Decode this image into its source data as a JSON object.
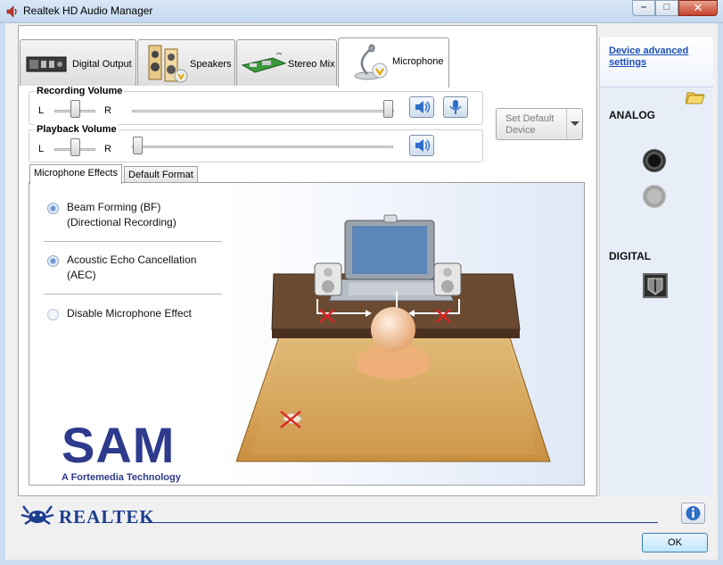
{
  "window": {
    "title": "Realtek HD Audio Manager"
  },
  "device_tabs": [
    {
      "label": "Digital Output",
      "icon": "digital-output-icon",
      "active": false
    },
    {
      "label": "Speakers",
      "icon": "speakers-icon",
      "active": false
    },
    {
      "label": "Stereo Mix",
      "icon": "stereo-mix-icon",
      "active": false
    },
    {
      "label": "Microphone",
      "icon": "microphone-icon",
      "active": true
    }
  ],
  "recording": {
    "label": "Recording Volume",
    "left_label": "L",
    "right_label": "R",
    "balance": 0.5,
    "level": 1.0
  },
  "playback": {
    "label": "Playback Volume",
    "left_label": "L",
    "right_label": "R",
    "balance": 0.5,
    "level": 0.0
  },
  "set_default": {
    "label": "Set Default Device"
  },
  "sub_tabs": [
    {
      "label": "Microphone Effects",
      "active": true
    },
    {
      "label": "Default Format",
      "active": false
    }
  ],
  "effects": [
    {
      "line1": "Beam Forming (BF)",
      "line2": "(Directional Recording)",
      "selected": true
    },
    {
      "line1": "Acoustic Echo Cancellation",
      "line2": "(AEC)",
      "selected": true
    },
    {
      "line1": "Disable Microphone Effect",
      "line2": "",
      "selected": false
    }
  ],
  "sam_logo": {
    "word": "SAM",
    "tagline": "A Fortemedia Technology"
  },
  "right_panel": {
    "link": "Device advanced settings",
    "analog": "ANALOG",
    "digital": "DIGITAL"
  },
  "footer": {
    "brand": "REALTEK",
    "ok": "OK"
  },
  "colors": {
    "link": "#1a4fb8",
    "brand": "#1d3d8f",
    "sam": "#2e3a8c"
  }
}
